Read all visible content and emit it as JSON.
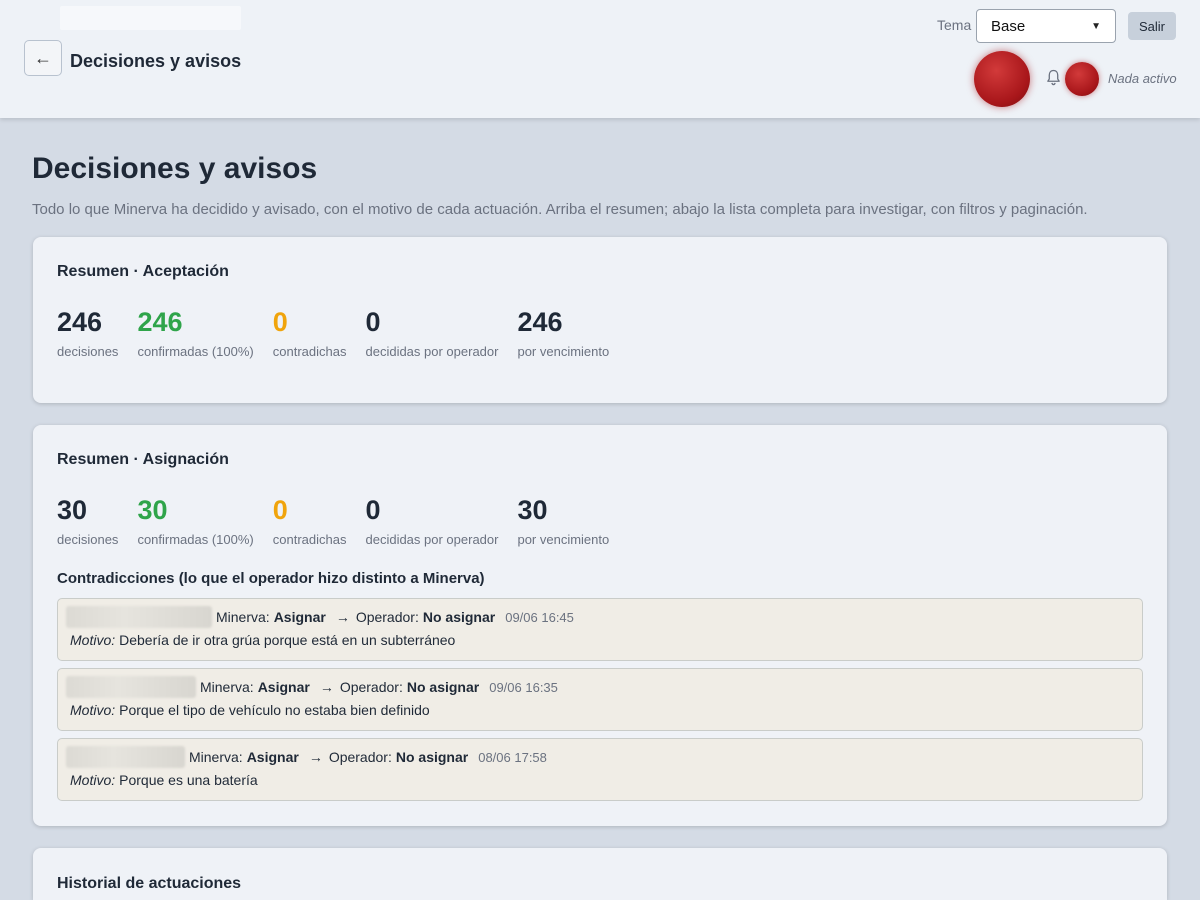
{
  "header": {
    "title": "Decisiones y avisos",
    "tema_label": "Tema",
    "tema_value": "Base",
    "salir_label": "Salir",
    "status": "Nada activo"
  },
  "page": {
    "title": "Decisiones y avisos",
    "subtitle": "Todo lo que Minerva ha decidido y avisado, con el motivo de cada actuación. Arriba el resumen; abajo la lista completa para investigar, con filtros y paginación."
  },
  "aceptacion": {
    "title": "Resumen · Aceptación",
    "stats": [
      {
        "value": "246",
        "label": "decisiones"
      },
      {
        "value": "246",
        "label": "confirmadas (100%)"
      },
      {
        "value": "0",
        "label": "contradichas"
      },
      {
        "value": "0",
        "label": "decididas por operador"
      },
      {
        "value": "246",
        "label": "por vencimiento"
      }
    ]
  },
  "asignacion": {
    "title": "Resumen · Asignación",
    "stats": [
      {
        "value": "30",
        "label": "decisiones"
      },
      {
        "value": "30",
        "label": "confirmadas (100%)"
      },
      {
        "value": "0",
        "label": "contradichas"
      },
      {
        "value": "0",
        "label": "decididas por operador"
      },
      {
        "value": "30",
        "label": "por vencimiento"
      }
    ],
    "contradicciones_title": "Contradicciones (lo que el operador hizo distinto a Minerva)",
    "contradicciones": [
      {
        "minerva_prefix": "Minerva:",
        "minerva_action": "Asignar",
        "arrow": "→",
        "operador_prefix": "Operador:",
        "operador_action": "No asignar",
        "timestamp": "09/06 16:45",
        "motivo_label": "Motivo:",
        "motivo": "Debería de ir otra grúa porque está en un subterráneo"
      },
      {
        "minerva_prefix": "Minerva:",
        "minerva_action": "Asignar",
        "arrow": "→",
        "operador_prefix": "Operador:",
        "operador_action": "No asignar",
        "timestamp": "09/06 16:35",
        "motivo_label": "Motivo:",
        "motivo": "Porque el tipo de vehículo no estaba bien definido"
      },
      {
        "minerva_prefix": "Minerva:",
        "minerva_action": "Asignar",
        "arrow": "→",
        "operador_prefix": "Operador:",
        "operador_action": "No asignar",
        "timestamp": "08/06 17:58",
        "motivo_label": "Motivo:",
        "motivo": "Porque es una batería"
      }
    ]
  },
  "historial": {
    "title": "Historial de actuaciones"
  },
  "colors": {
    "green": "#2fa44a",
    "amber": "#f0a40c",
    "alert_orb": "#a8161a"
  },
  "icons": [
    "back-arrow-icon",
    "bell-icon",
    "chevron-down-icon"
  ]
}
